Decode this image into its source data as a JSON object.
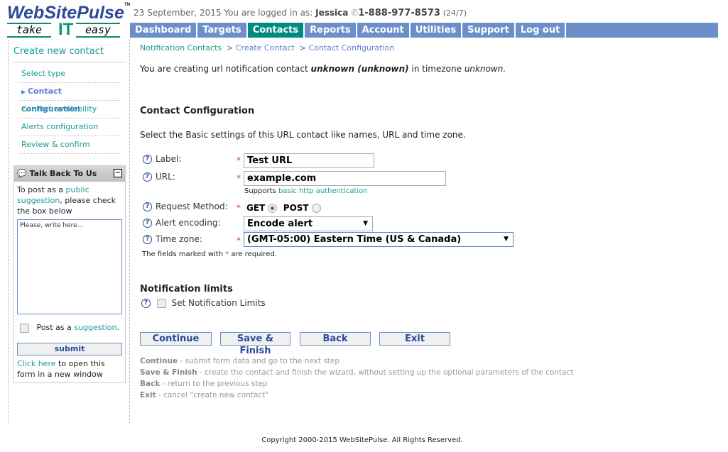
{
  "header": {
    "logo": "WebSitePulse",
    "tagline": [
      "take",
      "IT",
      "easy"
    ],
    "date": "23 September, 2015",
    "logged_in_label": "You are logged in as:",
    "user": "Jessica",
    "phone": "1-888-977-8573",
    "phone_hours": "(24/7)"
  },
  "nav": [
    {
      "label": "Dashboard"
    },
    {
      "label": "Targets"
    },
    {
      "label": "Contacts",
      "active": true
    },
    {
      "label": "Reports"
    },
    {
      "label": "Account"
    },
    {
      "label": "Utilities"
    },
    {
      "label": "Support"
    },
    {
      "label": "Log out"
    }
  ],
  "sidebar": {
    "title": "Create new contact",
    "steps": [
      {
        "label": "Select type"
      },
      {
        "label": "Contact configuration",
        "current": true
      },
      {
        "label": "Contact availability"
      },
      {
        "label": "Alerts configuration"
      },
      {
        "label": "Review & confirm"
      }
    ],
    "talkback": {
      "title": "Talk Back To Us",
      "intro_1": "To post as a",
      "intro_link": "public suggestion",
      "intro_2": ", please check the box below",
      "placeholder": "Please, write here...",
      "post_as": "Post as a",
      "post_link": "suggestion",
      "post_end": ".",
      "submit": "submit",
      "open_link": "Click here",
      "open_text": "to open this form in a new window"
    }
  },
  "breadcrumb": [
    "Notification Contacts",
    "Create Contact",
    "Contact Configuration"
  ],
  "intro": {
    "prefix": "You are creating url notification contact",
    "name": "unknown",
    "paren": "(unknown)",
    "tz_prefix": "in timezone",
    "tz": "unknown."
  },
  "section": {
    "title": "Contact Configuration",
    "desc": "Select the Basic settings of this URL contact like names, URL and time zone."
  },
  "form": {
    "label_label": "Label:",
    "label_value": "Test URL",
    "url_label": "URL:",
    "url_value": "example.com",
    "url_note": "Supports",
    "url_note_link": "basic http authentication",
    "method_label": "Request Method:",
    "method_get": "GET",
    "method_post": "POST",
    "method_selected": "GET",
    "encoding_label": "Alert encoding:",
    "encoding_value": "Encode alert",
    "tz_label": "Time zone:",
    "tz_value": "(GMT-05:00) Eastern Time (US & Canada)",
    "required_1": "The fields marked with",
    "required_star": "*",
    "required_2": "are required."
  },
  "limits": {
    "title": "Notification limits",
    "checkbox": "Set Notification Limits",
    "checked": false
  },
  "buttons": {
    "continue": "Continue",
    "save": "Save & Finish",
    "back": "Back",
    "exit": "Exit"
  },
  "help": [
    {
      "term": "Continue",
      "text": "- submit form data and go to the next step"
    },
    {
      "term": "Save & Finish",
      "text": "- create the contact and finish the wizard, without setting up the optional parameters of the contact"
    },
    {
      "term": "Back",
      "text": "- return to the previous step"
    },
    {
      "term": "Exit",
      "text": "- cancel \"create new contact\""
    }
  ],
  "footer": "Copyright 2000-2015 WebSitePulse. All Rights Reserved.",
  "colors": {
    "nav": "#6d8fc9",
    "nav_active": "#008b80",
    "link": "#1b9a95"
  }
}
